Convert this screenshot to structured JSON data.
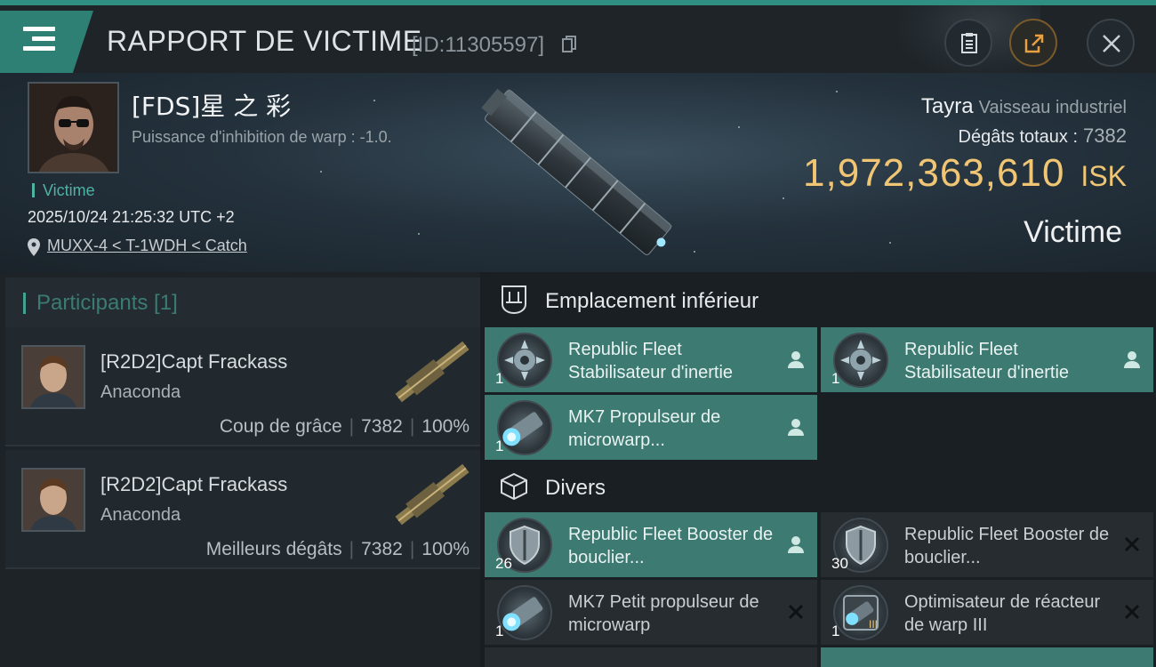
{
  "header": {
    "title": "RAPPORT DE VICTIME",
    "kill_id": "[ID:11305597]",
    "icons": [
      "menu-icon",
      "copy-icon",
      "clipboard-icon",
      "share-icon",
      "close-icon"
    ]
  },
  "victim": {
    "name": "[FDS]星 之 彩",
    "warp_text": "Puissance d'inhibition de warp : -1.0.",
    "tag": "Victime",
    "datetime": "2025/10/24 21:25:32 UTC +2",
    "location": "MUXX-4 < T-1WDH < Catch",
    "ship": "Tayra",
    "ship_class": "Vaisseau industriel",
    "damage_label": "Dégâts totaux :",
    "damage_value": "7382",
    "isk_value": "1,972,363,610",
    "isk_unit": "ISK",
    "role": "Victime"
  },
  "participants": {
    "title": "Participants [1]",
    "rows": [
      {
        "name": "[R2D2]Capt Frackass",
        "ship": "Anaconda",
        "label": "Coup de grâce",
        "damage": "7382",
        "percent": "100%"
      },
      {
        "name": "[R2D2]Capt Frackass",
        "ship": "Anaconda",
        "label": "Meilleurs dégâts",
        "damage": "7382",
        "percent": "100%"
      }
    ]
  },
  "fitting": {
    "low_title": "Emplacement inférieur",
    "misc_title": "Divers",
    "low_modules": [
      {
        "name": "Republic Fleet Stabilisateur d'inertie",
        "qty": "1",
        "status": "person",
        "style": "teal"
      },
      {
        "name": "Republic Fleet Stabilisateur d'inertie",
        "qty": "1",
        "status": "person",
        "style": "teal"
      },
      {
        "name": "MK7 Propulseur de microwarp...",
        "qty": "1",
        "status": "person",
        "style": "teal"
      }
    ],
    "misc_modules": [
      {
        "name": "Republic Fleet Booster de bouclier...",
        "qty": "26",
        "status": "person",
        "style": "teal"
      },
      {
        "name": "Republic Fleet Booster de bouclier...",
        "qty": "30",
        "status": "destroyed",
        "style": "dark"
      },
      {
        "name": "MK7 Petit propulseur de microwarp",
        "qty": "1",
        "status": "destroyed",
        "style": "dark"
      },
      {
        "name": "Optimisateur de réacteur de warp III",
        "qty": "1",
        "status": "destroyed",
        "style": "dark"
      }
    ]
  },
  "colors": {
    "accent": "#3fa293",
    "isk": "#f0c674",
    "teal_row": "#3d7a72"
  }
}
